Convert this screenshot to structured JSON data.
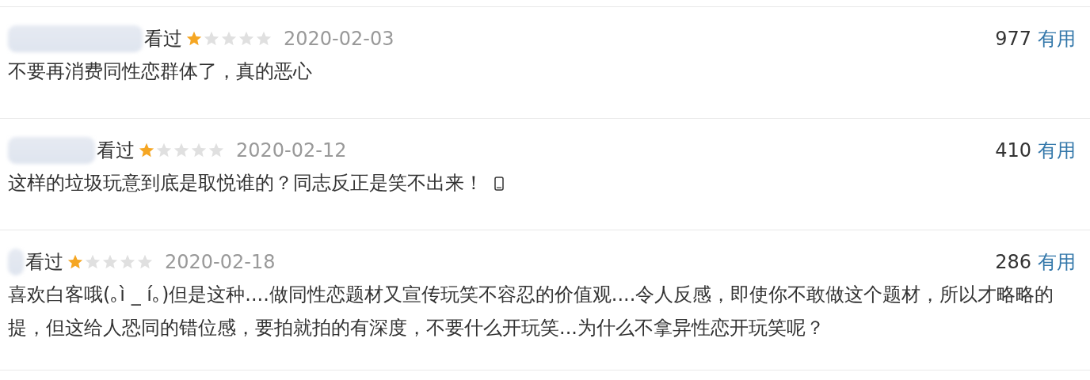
{
  "comments": [
    {
      "status": "看过",
      "stars": 1,
      "date": "2020-02-03",
      "votes": "977",
      "vote_label": "有用",
      "text": "不要再消费同性恋群体了，真的恶心",
      "mobile": false
    },
    {
      "status": "看过",
      "stars": 1,
      "date": "2020-02-12",
      "votes": "410",
      "vote_label": "有用",
      "text": "这样的垃圾玩意到底是取悦谁的？同志反正是笑不出来！",
      "mobile": true
    },
    {
      "status": "看过",
      "stars": 1,
      "date": "2020-02-18",
      "votes": "286",
      "vote_label": "有用",
      "text": "喜欢白客哦(｡ì _ í｡)但是这种....做同性恋题材又宣传玩笑不容忍的价值观....令人反感，即使你不敢做这个题材，所以才略略的提，但这给人恐同的错位感，要拍就拍的有深度，不要什么开玩笑...为什么不拿异性恋开玩笑呢？",
      "mobile": false
    }
  ]
}
